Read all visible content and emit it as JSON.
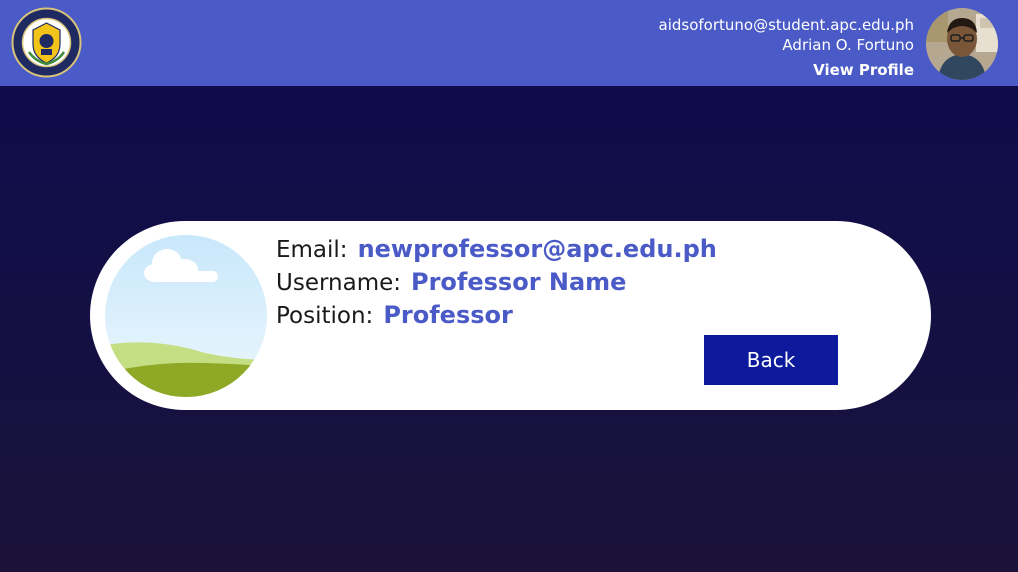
{
  "header": {
    "logo": {
      "name": "asia-pacific-college-logo",
      "text": "ASIA PACIFIC COLLEGE",
      "year": "1991"
    },
    "user": {
      "email": "aidsofortuno@student.apc.edu.ph",
      "name": "Adrian O. Fortuno",
      "view_profile_label": "View Profile"
    }
  },
  "profile_card": {
    "image_icon": "landscape-placeholder-icon",
    "fields": [
      {
        "label": "Email:",
        "value": "newprofessor@apc.edu.ph"
      },
      {
        "label": "Username:",
        "value": "Professor Name"
      },
      {
        "label": "Position:",
        "value": "Professor"
      }
    ],
    "back_label": "Back"
  },
  "colors": {
    "header_bg": "#4a5ac6",
    "page_bg": "#0d0a4f",
    "accent_text": "#4a5ac6",
    "button_bg": "#0c1a9b"
  }
}
